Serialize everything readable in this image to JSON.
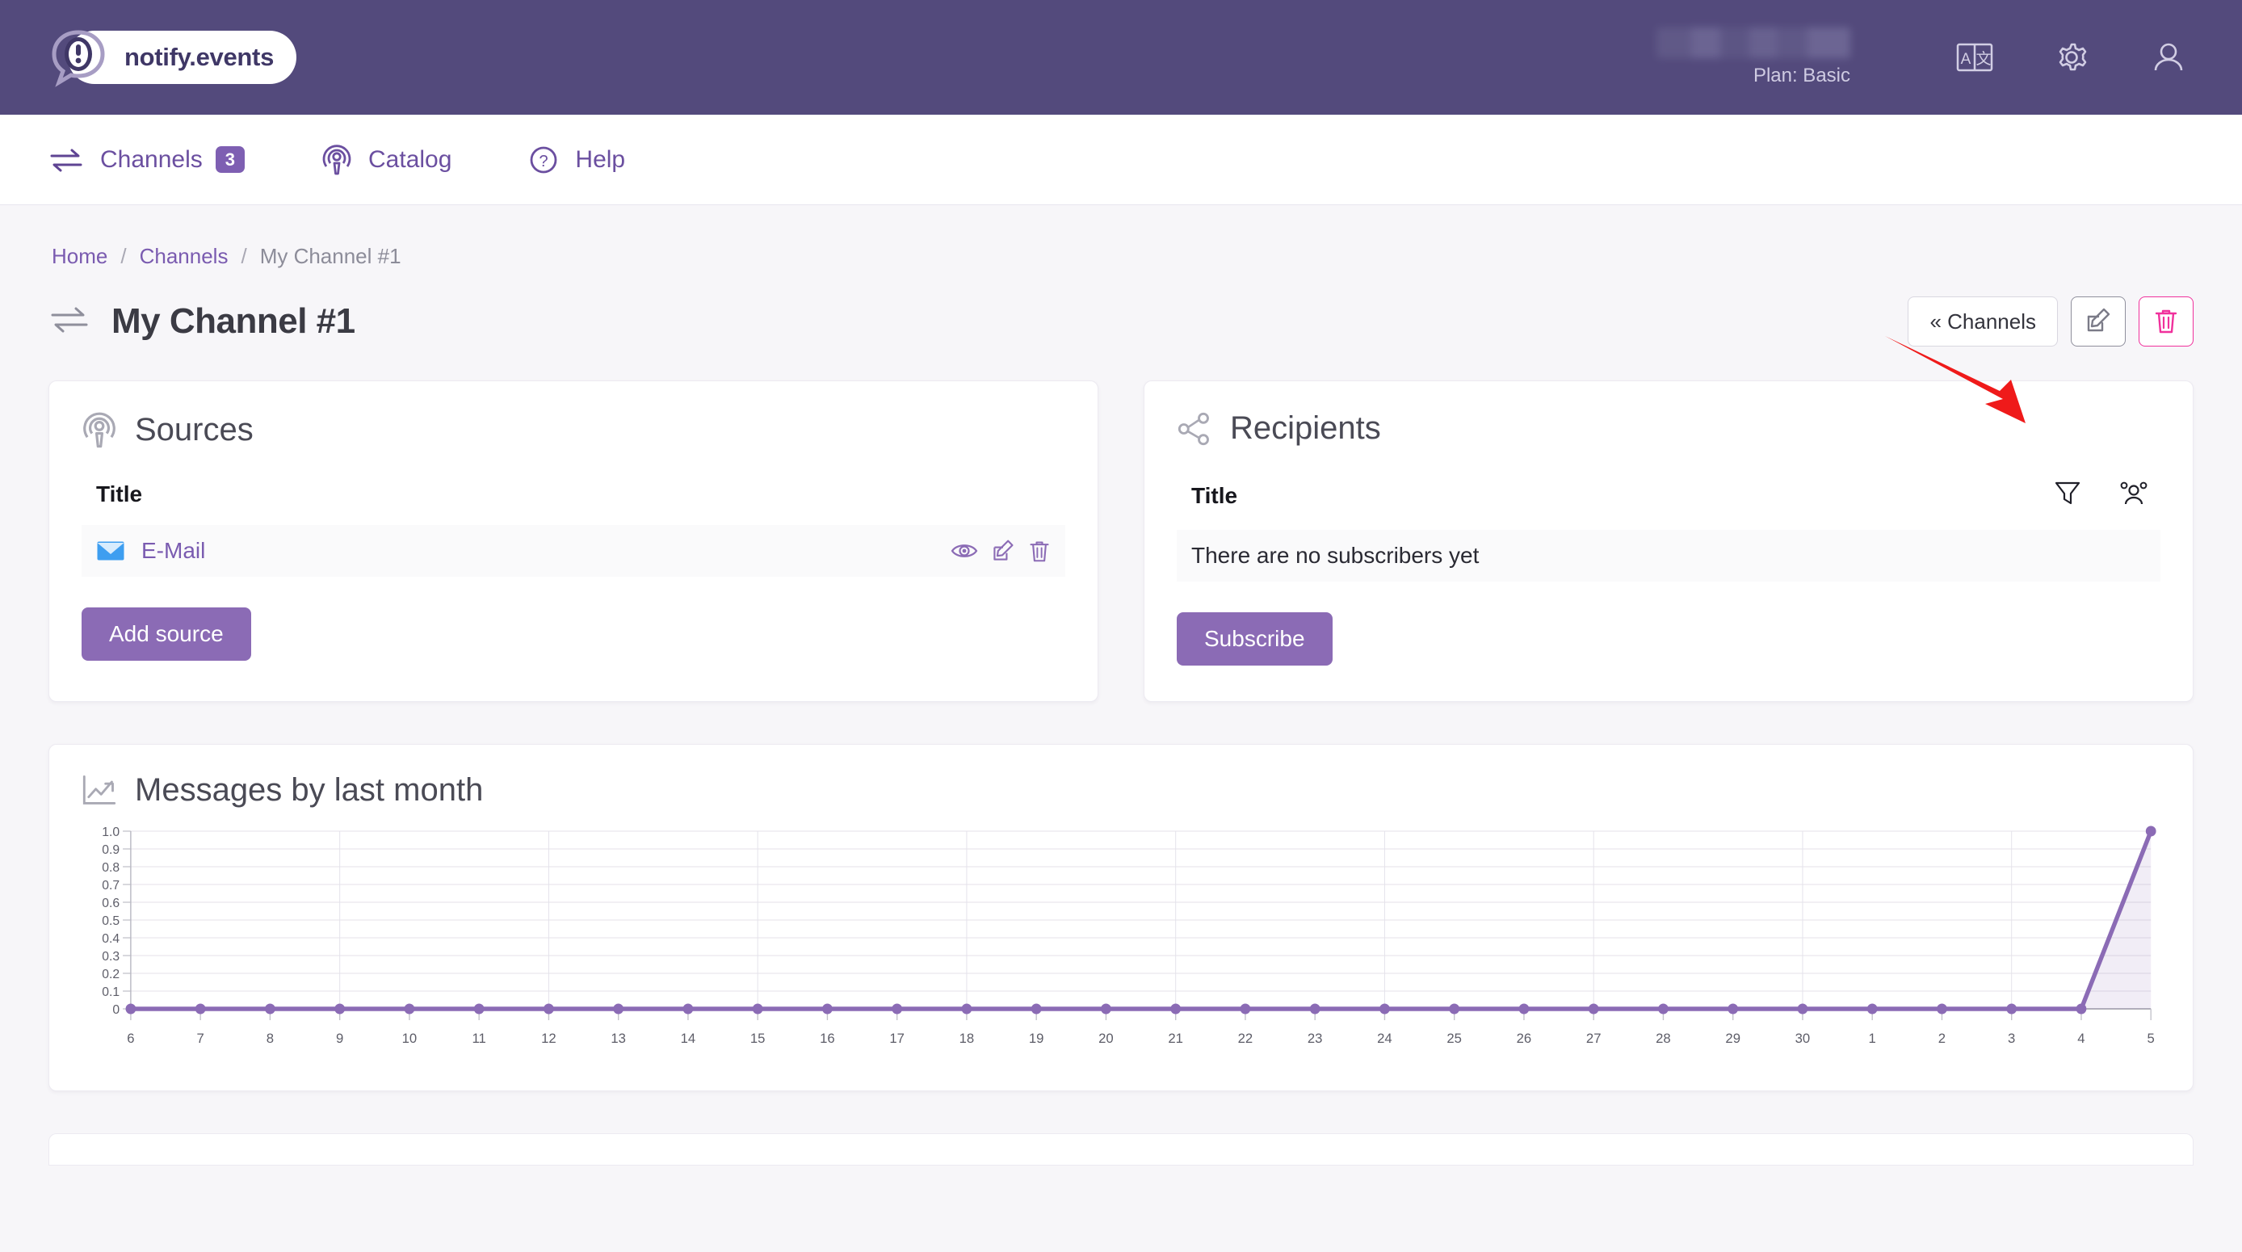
{
  "brand": {
    "name": "notify.events",
    "mark": "!"
  },
  "header": {
    "plan_label": "Plan: Basic",
    "user_name_redacted": "",
    "icons": [
      "translate-icon",
      "gear-icon",
      "user-icon"
    ]
  },
  "nav": {
    "items": [
      {
        "label": "Channels",
        "badge": "3",
        "icon": "channels-icon"
      },
      {
        "label": "Catalog",
        "badge": "",
        "icon": "catalog-icon"
      },
      {
        "label": "Help",
        "badge": "",
        "icon": "help-icon"
      }
    ]
  },
  "breadcrumb": {
    "home": "Home",
    "channels": "Channels",
    "current": "My Channel #1",
    "separator": "/"
  },
  "page": {
    "title": "My Channel #1",
    "back_button": "« Channels",
    "edit_button_icon": "edit-icon",
    "delete_button_icon": "trash-icon"
  },
  "sources": {
    "title": "Sources",
    "column_title": "Title",
    "rows": [
      {
        "name": "E-Mail",
        "icon": "envelope-icon",
        "actions": [
          "eye-icon",
          "edit-icon",
          "trash-icon"
        ]
      }
    ],
    "add_button": "Add source"
  },
  "recipients": {
    "title": "Recipients",
    "column_title": "Title",
    "header_actions": [
      "filter-icon",
      "group-icon"
    ],
    "empty_message": "There are no subscribers yet",
    "subscribe_button": "Subscribe"
  },
  "colors": {
    "header_purple": "#534a7c",
    "accent_purple": "#8b6bb5",
    "link_purple": "#7a5bb0",
    "danger_pink": "#f0319c",
    "chart_line": "#8b6bb5"
  },
  "chart_data": {
    "type": "line",
    "title": "Messages by last month",
    "xlabel": "",
    "ylabel": "",
    "ylim": [
      0,
      1.0
    ],
    "grid": true,
    "legend": "none",
    "categories": [
      "6",
      "7",
      "8",
      "9",
      "10",
      "11",
      "12",
      "13",
      "14",
      "15",
      "16",
      "17",
      "18",
      "19",
      "20",
      "21",
      "22",
      "23",
      "24",
      "25",
      "26",
      "27",
      "28",
      "29",
      "30",
      "1",
      "2",
      "3",
      "4",
      "5"
    ],
    "values": [
      0,
      0,
      0,
      0,
      0,
      0,
      0,
      0,
      0,
      0,
      0,
      0,
      0,
      0,
      0,
      0,
      0,
      0,
      0,
      0,
      0,
      0,
      0,
      0,
      0,
      0,
      0,
      0,
      0,
      1.0
    ],
    "ytick_labels": [
      "1.0",
      "0.9",
      "0.8",
      "0.7",
      "0.6",
      "0.5",
      "0.4",
      "0.3",
      "0.2",
      "0.1",
      "0"
    ],
    "ytick_values": [
      1.0,
      0.9,
      0.8,
      0.7,
      0.6,
      0.5,
      0.4,
      0.3,
      0.2,
      0.1,
      0
    ],
    "series": [
      {
        "name": "Messages",
        "values": [
          0,
          0,
          0,
          0,
          0,
          0,
          0,
          0,
          0,
          0,
          0,
          0,
          0,
          0,
          0,
          0,
          0,
          0,
          0,
          0,
          0,
          0,
          0,
          0,
          0,
          0,
          0,
          0,
          0,
          1.0
        ]
      }
    ]
  }
}
